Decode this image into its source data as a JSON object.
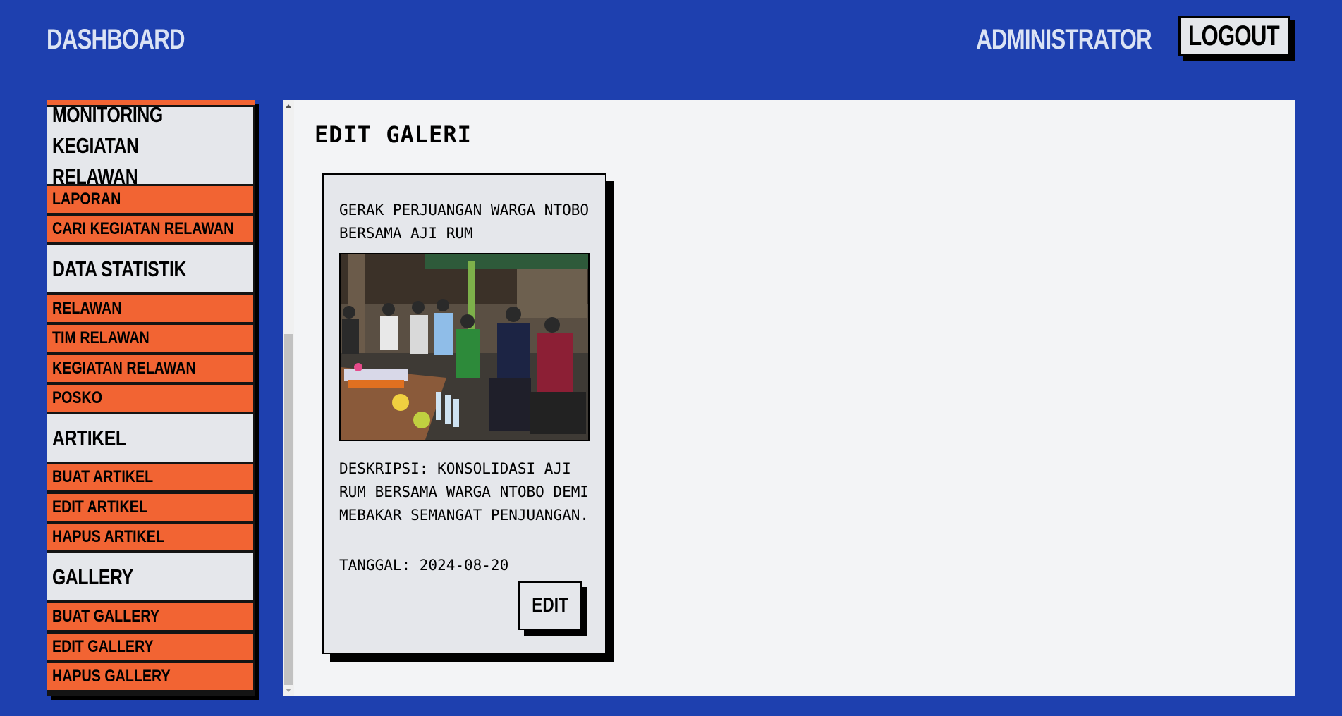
{
  "header": {
    "brand": "DASHBOARD",
    "user_role": "ADMINISTRATOR",
    "logout_label": "LOGOUT"
  },
  "sidebar": {
    "sections": [
      {
        "title": "MONITORING KEGIATAN RELAWAN",
        "items": [
          "LAPORAN",
          "CARI KEGIATAN RELAWAN"
        ]
      },
      {
        "title": "DATA STATISTIK",
        "items": [
          "RELAWAN",
          "TIM RELAWAN",
          "KEGIATAN RELAWAN",
          "POSKO"
        ]
      },
      {
        "title": "ARTIKEL",
        "items": [
          "BUAT ARTIKEL",
          "EDIT ARTIKEL",
          "HAPUS ARTIKEL"
        ]
      },
      {
        "title": "GALLERY",
        "items": [
          "BUAT GALLERY",
          "EDIT GALLERY",
          "HAPUS GALLERY"
        ]
      }
    ]
  },
  "main": {
    "title": "EDIT GALERI",
    "card": {
      "title": "GERAK PERJUANGAN WARGA NTOBO BERSAMA AJI RUM",
      "description": "DESKRIPSI: KONSOLIDASI AJI RUM BERSAMA WARGA NTOBO DEMI MEBAKAR SEMANGAT PENJUANGAN.",
      "date": "TANGGAL: 2024-08-20",
      "edit_label": "EDIT"
    }
  },
  "colors": {
    "background": "#1e40af",
    "sidebar_header": "#e5e7eb",
    "sidebar_item": "#f26433",
    "panel": "#f3f4f6"
  }
}
